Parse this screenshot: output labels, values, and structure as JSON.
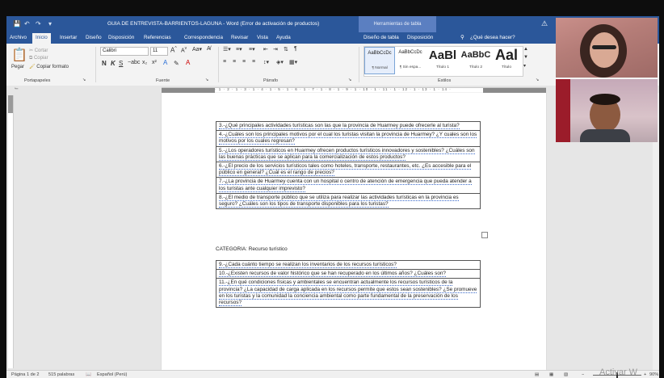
{
  "window": {
    "title": "GUIA DE ENTREVISTA-BARRIENTOS-LAGUNA  -  Word (Error de activación de productos)",
    "contextual_tab_title": "Herramientas de tabla"
  },
  "tabs": [
    "Archivo",
    "Inicio",
    "Insertar",
    "Diseño",
    "Disposición",
    "Referencias",
    "Correspondencia",
    "Revisar",
    "Vista",
    "Ayuda",
    "Diseño de tabla",
    "Disposición"
  ],
  "active_tab": "Inicio",
  "tell_me": "¿Qué desea hacer?",
  "ribbon": {
    "clipboard": {
      "paste": "Pegar",
      "cut": "Cortar",
      "copy": "Copiar",
      "format_painter": "Copiar formato",
      "label": "Portapapeles"
    },
    "font": {
      "name": "Calibri",
      "size": "11",
      "label": "Fuente"
    },
    "paragraph": {
      "label": "Párrafo"
    },
    "styles": {
      "label": "Estilos",
      "items": [
        {
          "sample": "AaBbCcDc",
          "name": "¶ Normal"
        },
        {
          "sample": "AaBbCcDc",
          "name": "¶ Sin espa..."
        },
        {
          "sample": "AaBl",
          "name": "Título 1"
        },
        {
          "sample": "AaBbC",
          "name": "Título 2"
        },
        {
          "sample": "Aal",
          "name": "Título"
        }
      ]
    }
  },
  "ruler_numbers": "· 1 · 2 · 1 · 3 · 1 · 4 · 1 · 5 · 1 · 6 · 1 · 7 · 1 · 8 · 1 · 9 · 1 · 10 · 1 · 11 · 1 · 12 · 1 · 13 · 1 · 14 ·",
  "document": {
    "table1": [
      "3.-¿Qué principales actividades turísticas son las que la provincia de Huarmey puede ofrecerle al turista?",
      "4.-¿Cuáles son los principales motivos por el cual los turistas visitan la provincia de Huarmey? ¿Y cuales son los motivos por los cuales regresan?",
      "5.-¿Los operadores turísticos en Huarmey ofrecen productos turísticos innovadores y sostenibles? ¿Cuáles son las buenas prácticas que se aplican para la comercialización de estos productos?",
      "6.-¿El precio de los servicios turísticos tales como hoteles, transporte, restaurantes, etc. ¿Es accesible para el público en general? ¿Cuál es el rango de precios?",
      "7.-¿La provincia de Huarmey cuenta con un hospital o centro de atención de emergencia que pueda atender a los turistas ante cualquier imprevisto?",
      "8.-¿El medio de transporte público que se utiliza para realizar las actividades turísticas en la provincia es seguro? ¿Cuáles son los tipos de transporte disponibles para los turistas?"
    ],
    "category": "CATEGORIA: Recurso turístico",
    "table2": [
      "9.-¿Cada cuánto tiempo se realizan los inventarios de los recursos turísticos?",
      "10.-¿Existen recursos de valor histórico que se han recuperado en los últimos años? ¿Cuáles son?",
      "11.-¿En qué condiciones físicas y ambientales se encuentran actualmente los recursos turísticos de la provincia? ¿La capacidad de carga aplicada en los recursos permite que estos sean sostenibles? ¿Se promueve en los turistas y la comunidad la conciencia ambiental como parte fundamental de la preservación de los recursos?"
    ]
  },
  "status": {
    "page": "Página 1 de 2",
    "words": "515 palabras",
    "language": "Español (Perú)",
    "zoom": "90%"
  },
  "overlay_text": "Activar W",
  "colors": {
    "word_blue": "#2b579a",
    "ribbon_bg": "#f3f3f3"
  }
}
